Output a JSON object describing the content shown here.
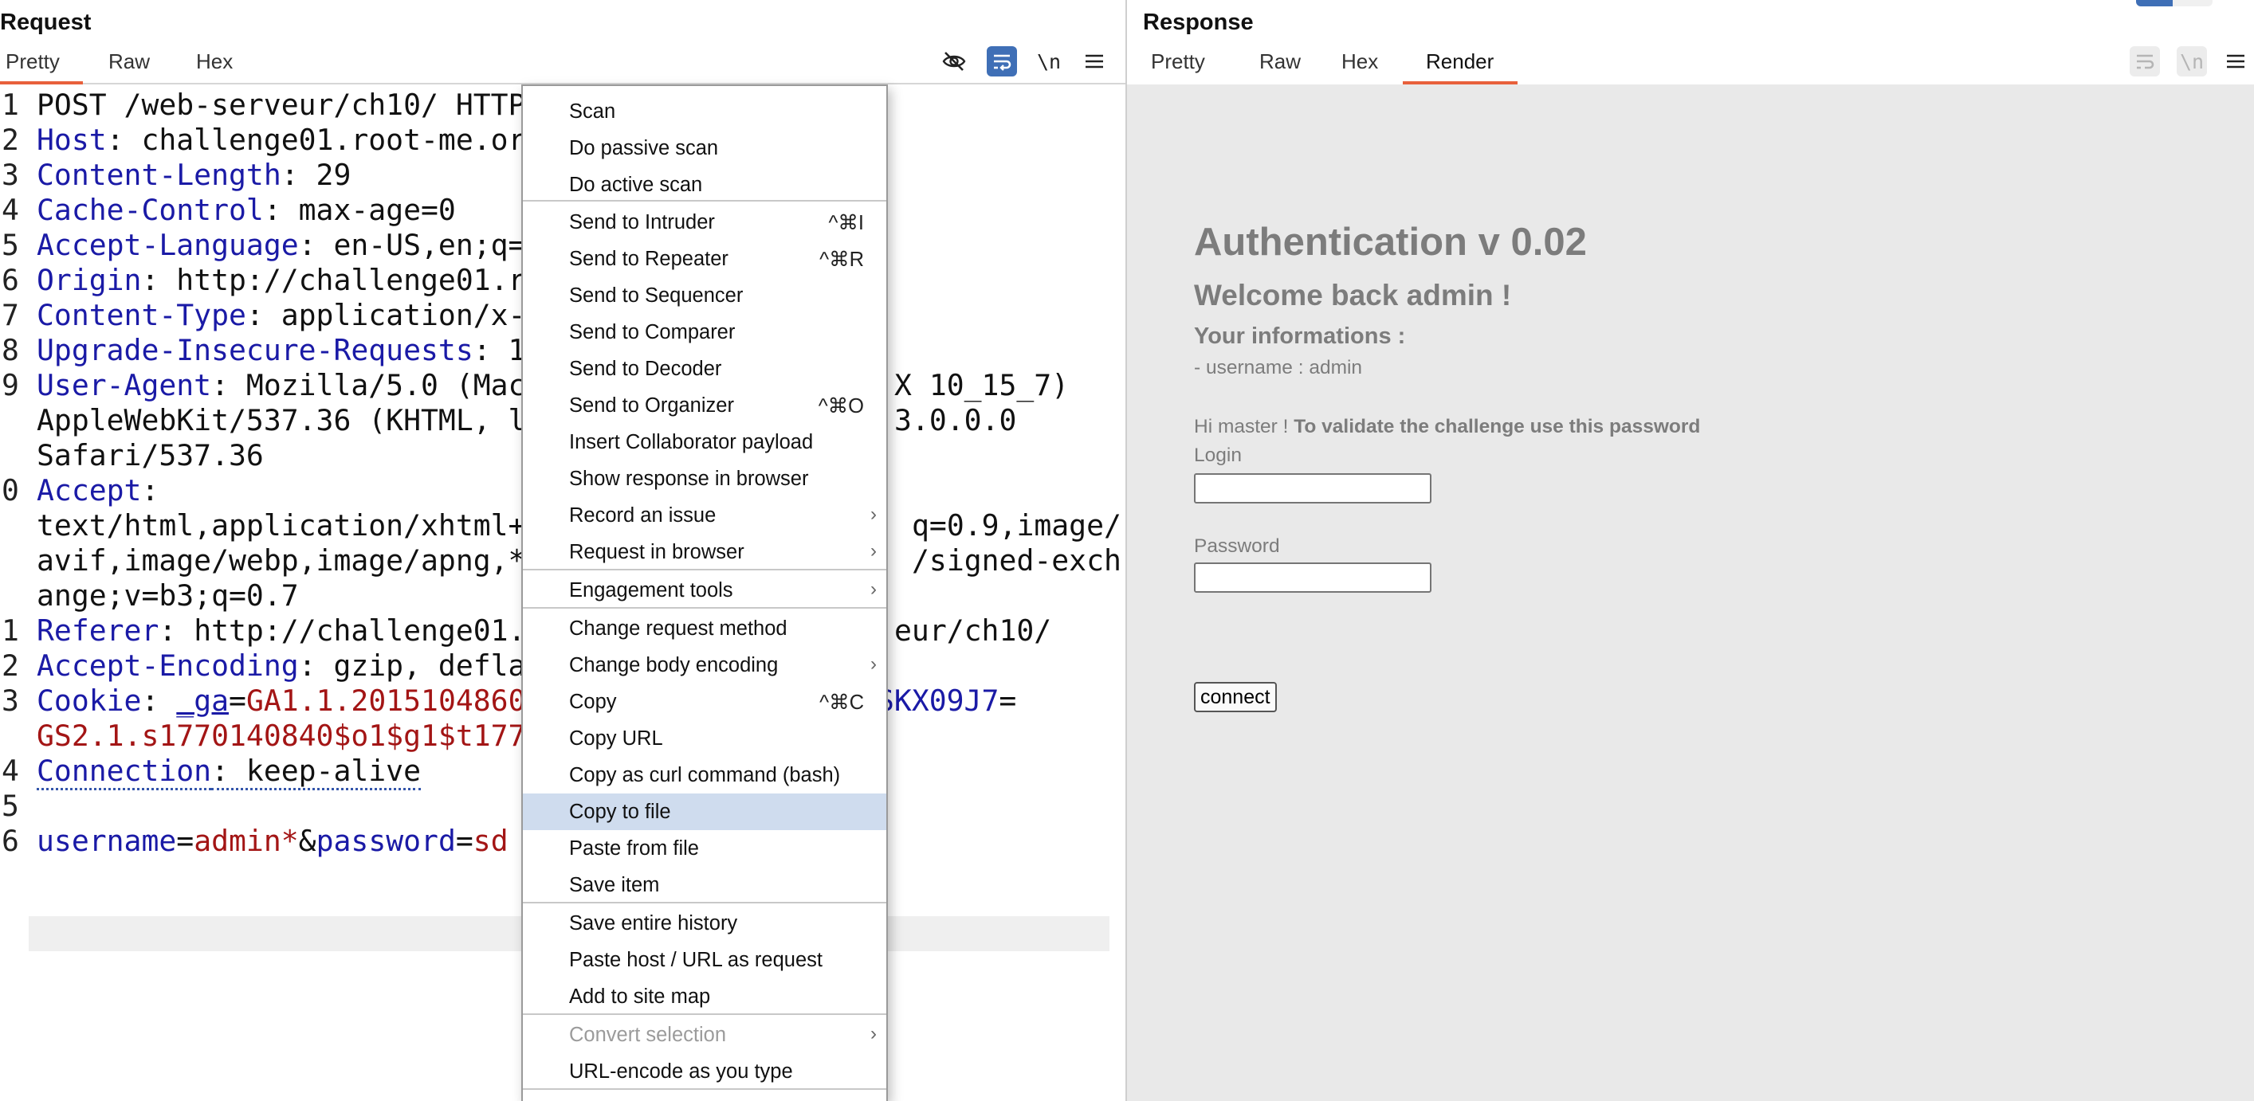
{
  "request": {
    "title": "Request",
    "tabs": [
      "Pretty",
      "Raw",
      "Hex"
    ],
    "active_tab": "Pretty",
    "toolbar": {
      "hide_icon": "eye-off-icon",
      "wrap_icon": "word-wrap-icon",
      "newline_label": "\\n",
      "menu_icon": "hamburger-menu-icon"
    },
    "gutter": [
      "1",
      "2",
      "3",
      "4",
      "5",
      "6",
      "7",
      "8",
      "9",
      "",
      "",
      "0",
      "",
      "",
      "1",
      "2",
      "3",
      "",
      "4",
      "5",
      "6"
    ],
    "lines": {
      "l1": "POST /web-serveur/ch10/ HTTP",
      "l2k": "Host",
      "l2v": ": challenge01.root-me.or",
      "l3k": "Content-Length",
      "l3v": ": 29",
      "l4k": "Cache-Control",
      "l4v": ": max-age=0",
      "l5k": "Accept-Language",
      "l5v": ": en-US,en;q=",
      "l6k": "Origin",
      "l6v": ": http://challenge01.r",
      "l7k": "Content-Type",
      "l7v": ": application/x-",
      "l8k": "Upgrade-Insecure-Requests",
      "l8v": ": 1",
      "l9k": "User-Agent",
      "l9v": ": Mozilla/5.0 (Mac",
      "l9tail": "X 10_15_7)",
      "l9b": "AppleWebKit/537.36 (KHTML, l",
      "l9btail": "3.0.0.0",
      "l9c": "Safari/537.36",
      "l10k": "Accept",
      "l10v": ":",
      "l10b": "text/html,application/xhtml+",
      "l10btail": "q=0.9,image/",
      "l10c": "avif,image/webp,image/apng,*",
      "l10ctail": "/signed-exch",
      "l10d": "ange;v=b3;q=0.7",
      "l11k": "Referer",
      "l11v": ": http://challenge01.",
      "l11tail": "eur/ch10/",
      "l12k": "Accept-Encoding",
      "l12v": ": gzip, defla",
      "l13k": "Cookie",
      "l13sep": ": ",
      "l13ck": "_ga",
      "l13eq": "=",
      "l13cv": "GA1.1.2015104860",
      "l13tail": "SKX09J7",
      "l13tail2": "=",
      "l13b": "GS2.1.s1770140840$o1$g1$t177",
      "l14k": "Connection",
      "l14v": ": keep-alive",
      "l16k1": "username",
      "l16eq1": "=",
      "l16v1": "admin*",
      "l16amp": "&",
      "l16k2": "password",
      "l16eq2": "=",
      "l16v2": "sd"
    }
  },
  "response": {
    "title": "Response",
    "tabs": [
      "Pretty",
      "Raw",
      "Hex",
      "Render"
    ],
    "active_tab": "Render",
    "toolbar": {
      "wrap_icon": "word-wrap-icon",
      "newline_label": "\\n",
      "menu_icon": "hamburger-menu-icon"
    },
    "render": {
      "heading": "Authentication v 0.02",
      "welcome": "Welcome back admin !",
      "info_heading": "Your informations :",
      "username_line": "- username : admin",
      "hint_plain": "Hi master ! ",
      "hint_bold": "To validate the challenge use this password",
      "login_label": "Login",
      "password_label": "Password",
      "connect_label": "connect"
    }
  },
  "context_menu": {
    "items": [
      {
        "label": "Scan"
      },
      {
        "label": "Do passive scan"
      },
      {
        "label": "Do active scan"
      },
      {
        "label": "Send to Intruder",
        "shortcut": "^⌘I"
      },
      {
        "label": "Send to Repeater",
        "shortcut": "^⌘R"
      },
      {
        "label": "Send to Sequencer"
      },
      {
        "label": "Send to Comparer"
      },
      {
        "label": "Send to Decoder"
      },
      {
        "label": "Send to Organizer",
        "shortcut": "^⌘O"
      },
      {
        "label": "Insert Collaborator payload"
      },
      {
        "label": "Show response in browser"
      },
      {
        "label": "Record an issue",
        "submenu": true
      },
      {
        "label": "Request in browser",
        "submenu": true
      },
      {
        "label": "Engagement tools",
        "submenu": true
      },
      {
        "label": "Change request method"
      },
      {
        "label": "Change body encoding",
        "submenu": true
      },
      {
        "label": "Copy",
        "shortcut": "^⌘C"
      },
      {
        "label": "Copy URL"
      },
      {
        "label": "Copy as curl command (bash)"
      },
      {
        "label": "Copy to file",
        "highlighted": true
      },
      {
        "label": "Paste from file"
      },
      {
        "label": "Save item"
      },
      {
        "label": "Save entire history"
      },
      {
        "label": "Paste host / URL as request"
      },
      {
        "label": "Add to site map"
      },
      {
        "label": "Convert selection",
        "submenu": true,
        "disabled": true
      },
      {
        "label": "URL-encode as you type"
      }
    ],
    "submenu_arrow": "›",
    "highlight_color": "#cfdcee"
  },
  "colors": {
    "tab_accent": "#e8603c",
    "header_key": "#1a1aa6",
    "cookie_value": "#a31515",
    "render_background": "#e9e9e9",
    "wrap_button_active": "#3f6fb6"
  }
}
